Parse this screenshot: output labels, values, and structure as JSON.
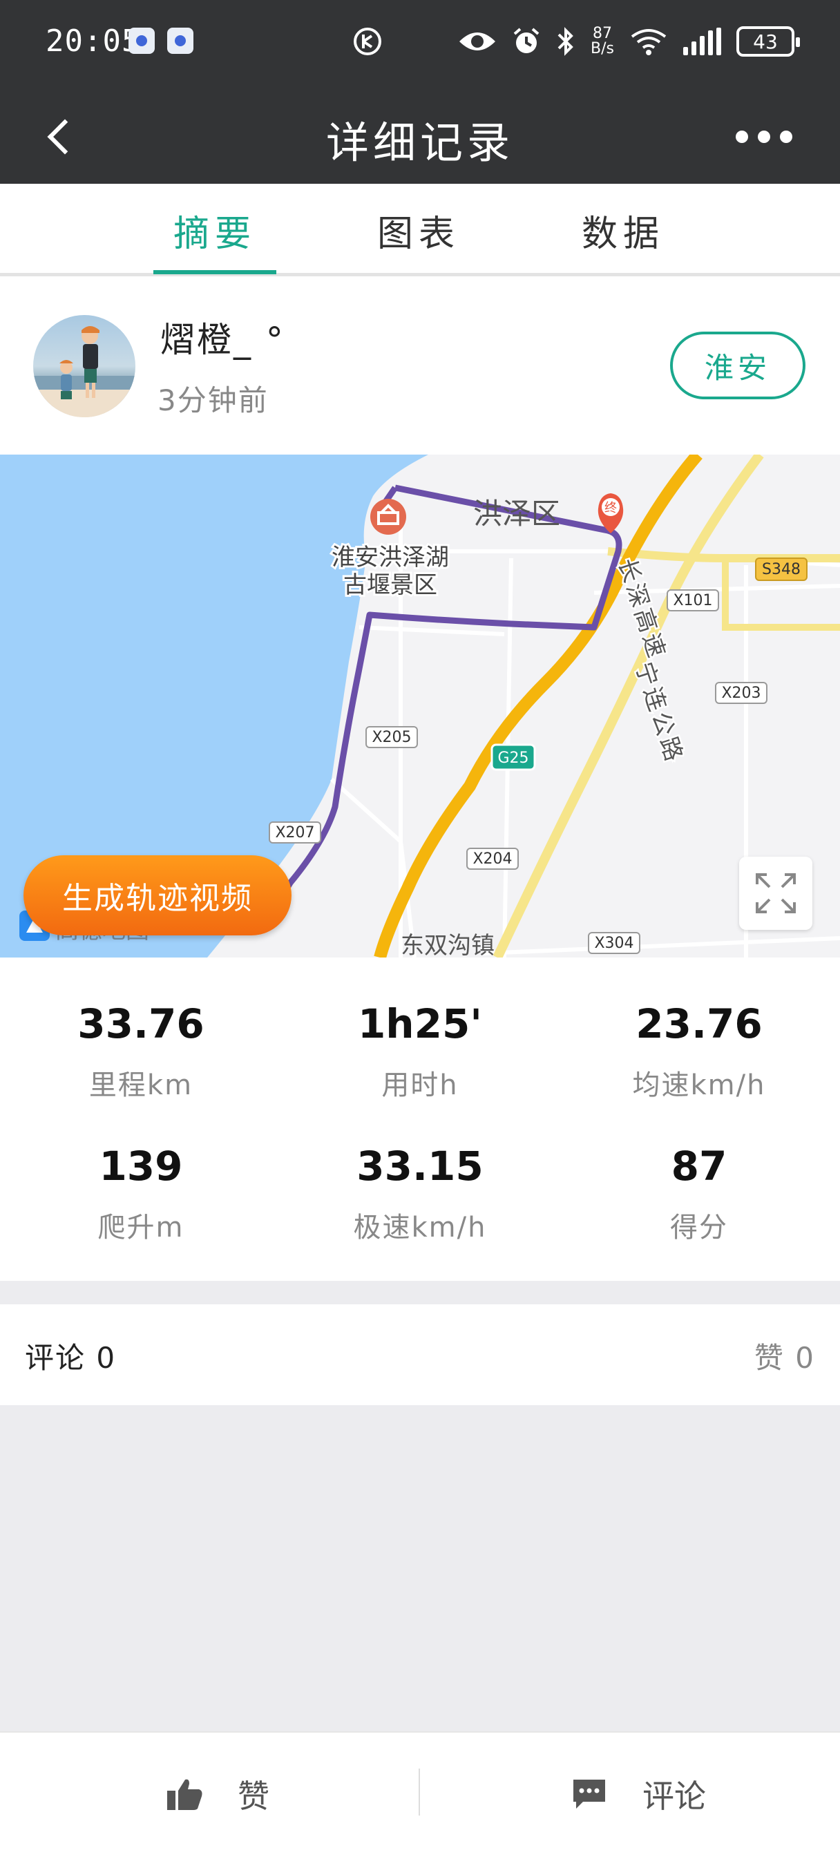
{
  "status_bar": {
    "time": "20:05",
    "net_speed_value": "87",
    "net_speed_unit": "B/s",
    "battery": "43"
  },
  "header": {
    "title": "详细记录"
  },
  "tabs": [
    {
      "label": "摘要",
      "active": true
    },
    {
      "label": "图表",
      "active": false
    },
    {
      "label": "数据",
      "active": false
    }
  ],
  "user": {
    "name": "熠橙_ °",
    "time_ago": "3分钟前",
    "location_button": "淮安"
  },
  "map": {
    "labels": {
      "district": "洪泽区",
      "scenic_line1": "淮安洪泽湖",
      "scenic_line2": "古堰景区",
      "expressway_name": "长深高速",
      "highway_name": "宁连公路",
      "road_s348": "S348",
      "road_x101": "X101",
      "road_x203": "X203",
      "road_x205": "X205",
      "road_g25": "G25",
      "road_x207": "X207",
      "road_x204": "X204",
      "road_x304": "X304",
      "town_partial": "东双沟镇",
      "watermark": "高德地图",
      "start_marker": "",
      "end_marker": "终"
    },
    "generate_video_label": "生成轨迹视频",
    "colors": {
      "water": "#9fd0fa",
      "route": "#6a4fa8",
      "expressway": "#f5b50c",
      "highway": "#f6e58a"
    }
  },
  "stats": [
    {
      "value": "33.76",
      "label": "里程km"
    },
    {
      "value": "1h25'",
      "label": "用时h"
    },
    {
      "value": "23.76",
      "label": "均速km/h"
    },
    {
      "value": "139",
      "label": "爬升m"
    },
    {
      "value": "33.15",
      "label": "极速km/h"
    },
    {
      "value": "87",
      "label": "得分"
    }
  ],
  "comments": {
    "comment_label": "评论 0",
    "like_label": "赞 0"
  },
  "bottom_bar": {
    "like_label": "赞",
    "comment_label": "评论"
  },
  "accent_color": "#1aa88d"
}
